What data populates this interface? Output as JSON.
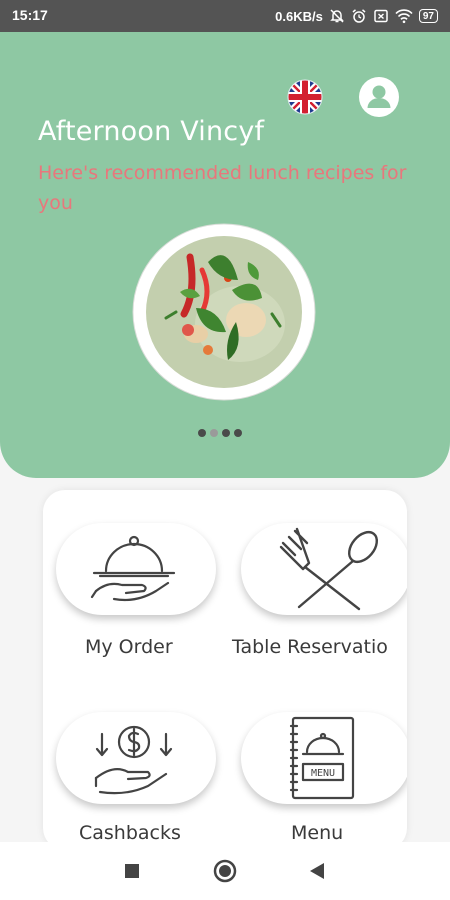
{
  "status_bar": {
    "time": "15:17",
    "network_speed": "0.6KB/s",
    "battery_level": "97"
  },
  "hero": {
    "greeting": "Afternoon Vincyf",
    "subtitle": "Here's recommended lunch recipes for you",
    "background_color": "#8ec8a3",
    "subtitle_color": "#e8777c",
    "carousel": {
      "dot_count": 4,
      "active_index": 1
    }
  },
  "menu": {
    "items": [
      {
        "label": "My Order",
        "icon": "cloche-hand-icon"
      },
      {
        "label": "Table Reservatio",
        "icon": "fork-spoon-icon"
      },
      {
        "label": "Cashbacks",
        "icon": "cashback-hand-icon"
      },
      {
        "label": "Menu",
        "icon": "menu-book-icon"
      }
    ]
  },
  "nav_bar": {
    "buttons": [
      "recents-button",
      "home-button",
      "back-button"
    ]
  }
}
